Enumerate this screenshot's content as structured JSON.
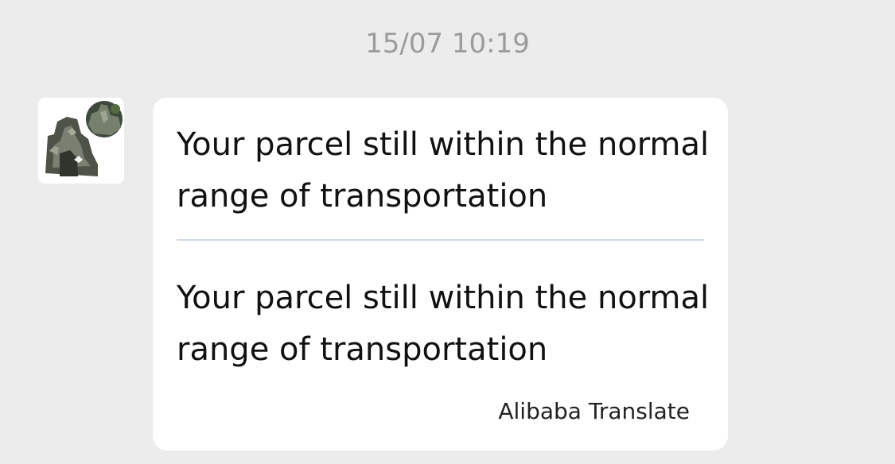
{
  "chat": {
    "timestamp": "15/07 10:19",
    "avatar_icon": "product-thumbnail-icon",
    "message": {
      "original_text": "Your parcel still within the normal range of transportation",
      "translated_text": "Your parcel still within the normal range of transportation",
      "translation_provider": "Alibaba Translate"
    }
  },
  "colors": {
    "background": "#ececec",
    "bubble": "#ffffff",
    "timestamp_text": "#9b9b9b",
    "divider": "#cfdbe5"
  }
}
